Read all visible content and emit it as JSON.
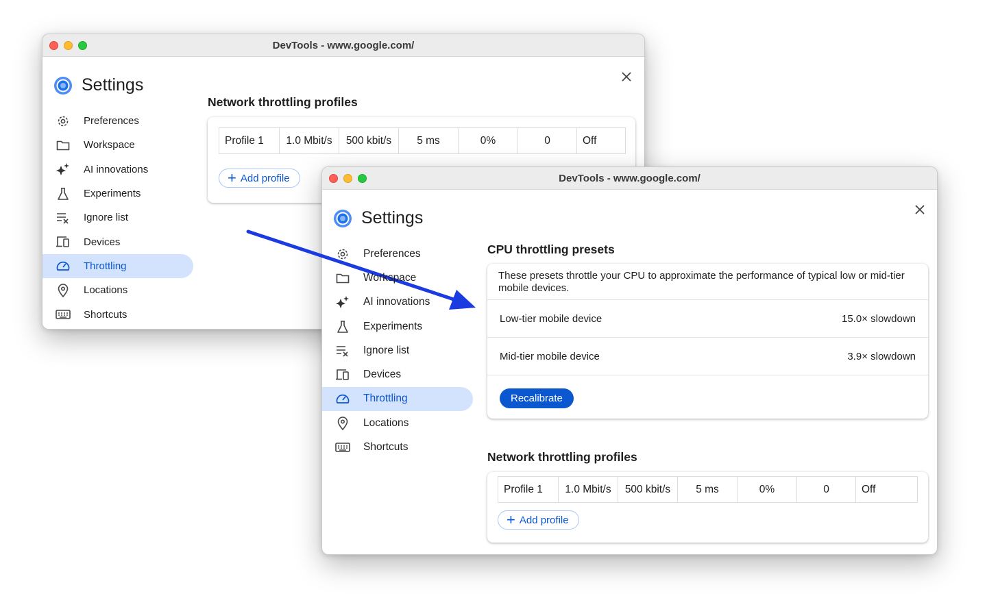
{
  "window_title": "DevTools - www.google.com/",
  "settings_title": "Settings",
  "nav": [
    {
      "label": "Preferences",
      "icon": "gear-icon"
    },
    {
      "label": "Workspace",
      "icon": "folder-icon"
    },
    {
      "label": "AI innovations",
      "icon": "sparkle-icon"
    },
    {
      "label": "Experiments",
      "icon": "flask-icon"
    },
    {
      "label": "Ignore list",
      "icon": "ignore-list-icon"
    },
    {
      "label": "Devices",
      "icon": "devices-icon"
    },
    {
      "label": "Throttling",
      "icon": "speedometer-icon",
      "active": true
    },
    {
      "label": "Locations",
      "icon": "location-pin-icon"
    },
    {
      "label": "Shortcuts",
      "icon": "keyboard-icon"
    }
  ],
  "network": {
    "title": "Network throttling profiles",
    "profile": [
      "Profile 1",
      "1.0 Mbit/s",
      "500 kbit/s",
      "5 ms",
      "0%",
      "0",
      "Off"
    ],
    "add_label": "Add profile"
  },
  "cpu": {
    "title": "CPU throttling presets",
    "description": "These presets throttle your CPU to approximate the performance of typical low or mid-tier mobile devices.",
    "presets": [
      {
        "name": "Low-tier mobile device",
        "value": "15.0× slowdown"
      },
      {
        "name": "Mid-tier mobile device",
        "value": "3.9× slowdown"
      }
    ],
    "recalibrate_label": "Recalibrate"
  },
  "colors": {
    "accent": "#0b57d0",
    "active_bg": "#d3e3fd",
    "arrow": "#1a3be0"
  }
}
